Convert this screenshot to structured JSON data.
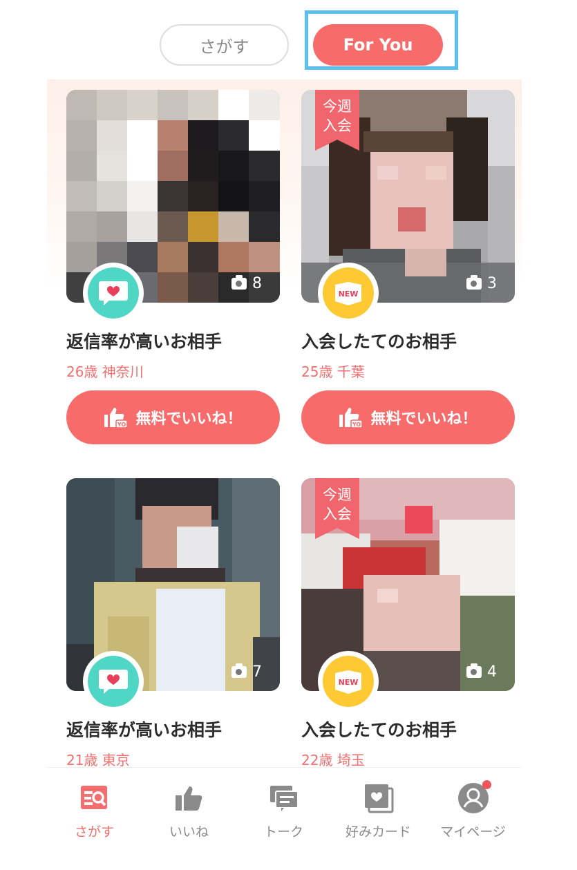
{
  "colors": {
    "accent": "#f76b6b",
    "reply_badge": "#4fd6c4",
    "new_badge": "#ffc933",
    "focus_outline": "#5bbfee"
  },
  "tabs": [
    {
      "label": "さがす",
      "active": false
    },
    {
      "label": "For You",
      "active": true
    }
  ],
  "cards": [
    {
      "title": "返信率が高いお相手",
      "age_location": "26歳 神奈川",
      "photo_count": "8",
      "badge": "reply-heart-icon",
      "ribbon": "",
      "like_label": "無料でいいね！"
    },
    {
      "title": "入会したてのお相手",
      "age_location": "25歳 千葉",
      "photo_count": "3",
      "badge": "new-icon",
      "ribbon": "今週入会",
      "like_label": "無料でいいね！"
    },
    {
      "title": "返信率が高いお相手",
      "age_location": "21歳 東京",
      "photo_count": "7",
      "badge": "reply-heart-icon",
      "ribbon": ""
    },
    {
      "title": "入会したてのお相手",
      "age_location": "22歳 埼玉",
      "photo_count": "4",
      "badge": "new-icon",
      "ribbon": "今週入会"
    }
  ],
  "ribbon_lines": [
    "今週",
    "入会"
  ],
  "new_badge_text": "NEW",
  "nav": [
    {
      "label": "さがす",
      "icon": "search-cards-icon",
      "active": true
    },
    {
      "label": "いいね",
      "icon": "thumbs-up-icon",
      "active": false
    },
    {
      "label": "トーク",
      "icon": "chat-icon",
      "active": false
    },
    {
      "label": "好みカード",
      "icon": "card-heart-icon",
      "active": false
    },
    {
      "label": "マイページ",
      "icon": "user-icon",
      "active": false,
      "notification": true
    }
  ]
}
